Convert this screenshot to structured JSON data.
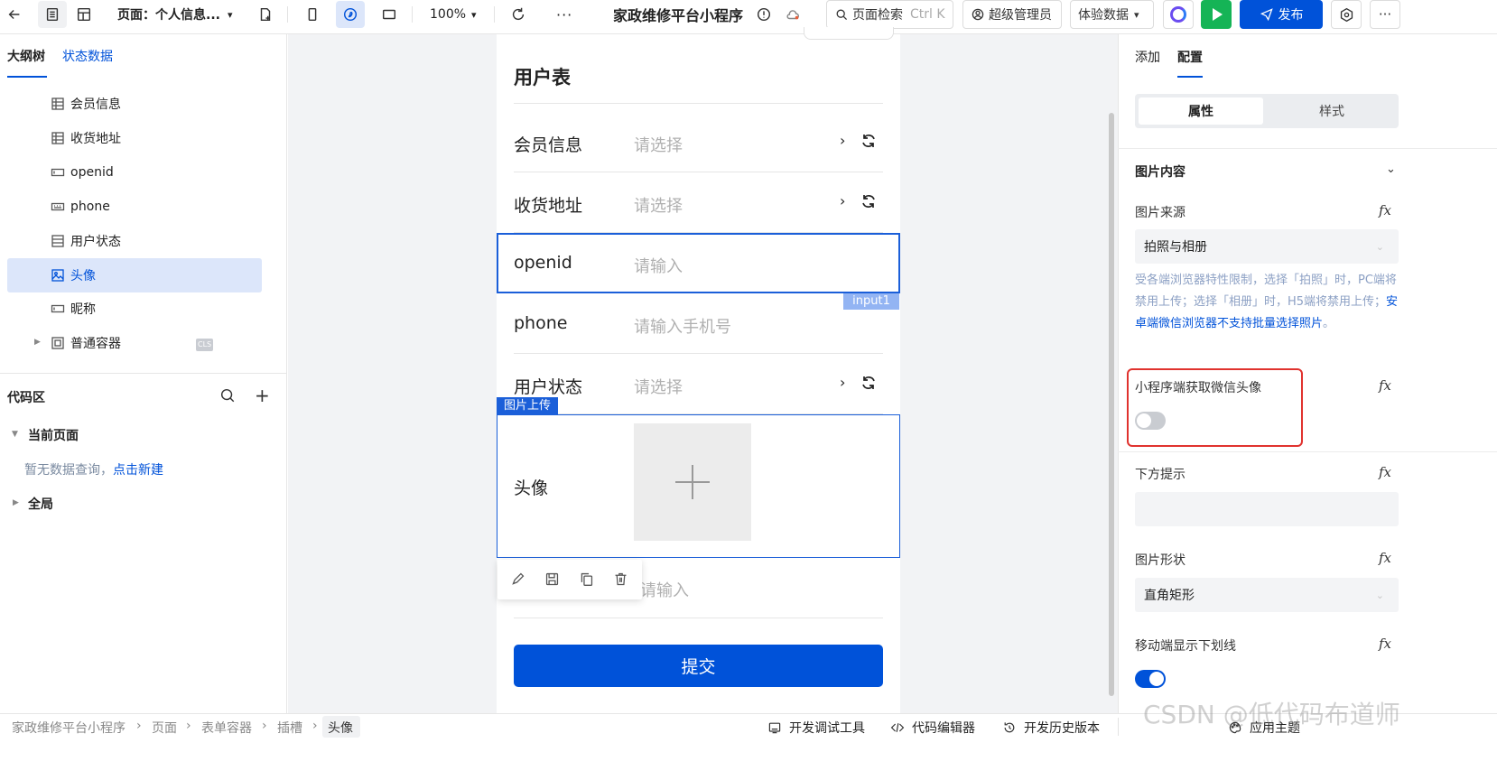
{
  "topbar": {
    "page_label": "页面：个人信息...",
    "zoom": "100%",
    "app_title": "家政维修平台小程序",
    "search_label": "页面检索",
    "search_shortcut": "Ctrl K",
    "user_label": "超级管理员",
    "data_mode": "体验数据",
    "publish_label": "发布"
  },
  "left_panel": {
    "tabs": [
      "大纲树",
      "状态数据"
    ],
    "tree": [
      {
        "label": "会员信息",
        "icon": "form-select-icon"
      },
      {
        "label": "收货地址",
        "icon": "form-select-icon"
      },
      {
        "label": "openid",
        "icon": "input-icon"
      },
      {
        "label": "phone",
        "icon": "phone-input-icon"
      },
      {
        "label": "用户状态",
        "icon": "form-select-icon"
      },
      {
        "label": "头像",
        "icon": "image-upload-icon"
      },
      {
        "label": "昵称",
        "icon": "input-icon"
      },
      {
        "label": "普通容器",
        "icon": "container-icon",
        "badge": "CLS"
      }
    ],
    "code_area": {
      "title": "代码区",
      "current_page": "当前页面",
      "empty_text": "暂无数据查询，",
      "create_link": "点击新建",
      "global": "全局"
    }
  },
  "canvas": {
    "form_title": "用户表",
    "fields": [
      {
        "label": "会员信息",
        "placeholder": "请选择"
      },
      {
        "label": "收货地址",
        "placeholder": "请选择"
      },
      {
        "label": "openid",
        "placeholder": "请输入"
      },
      {
        "label": "phone",
        "placeholder": "请输入手机号"
      },
      {
        "label": "用户状态",
        "placeholder": "请选择"
      },
      {
        "label": "头像",
        "placeholder": ""
      },
      {
        "label": "",
        "placeholder": "请输入"
      }
    ],
    "openid_tag": "input1",
    "upload_tag": "图片上传",
    "submit_label": "提交"
  },
  "right_panel": {
    "tabs": [
      "添加",
      "配置"
    ],
    "segments": [
      "属性",
      "样式"
    ],
    "section_title": "图片内容",
    "source_label": "图片来源",
    "source_value": "拍照与相册",
    "hint_text": "受各端浏览器特性限制，选择「拍照」时，PC端将禁用上传；选择「相册」时，H5端将禁用上传；",
    "hint_link": "安卓端微信浏览器不支持批量选择照片",
    "hint_end": "。",
    "wechat_avatar_label": "小程序端获取微信头像",
    "wechat_avatar_on": false,
    "bottom_hint_label": "下方提示",
    "shape_label": "图片形状",
    "shape_value": "直角矩形",
    "underline_label": "移动端显示下划线",
    "underline_on": true,
    "fx_symbol": "fx"
  },
  "bottom_bar": {
    "breadcrumb": [
      "家政维修平台小程序",
      "页面",
      "表单容器",
      "插槽",
      "头像"
    ],
    "tools": [
      "开发调试工具",
      "代码编辑器",
      "开发历史版本"
    ],
    "theme_label": "应用主题",
    "watermark": "CSDN @低代码布道师"
  },
  "colors": {
    "primary": "#0052d9",
    "publish_green": "#15b456",
    "selected_bg": "#dce6fa",
    "highlight_red": "#e0322e"
  }
}
